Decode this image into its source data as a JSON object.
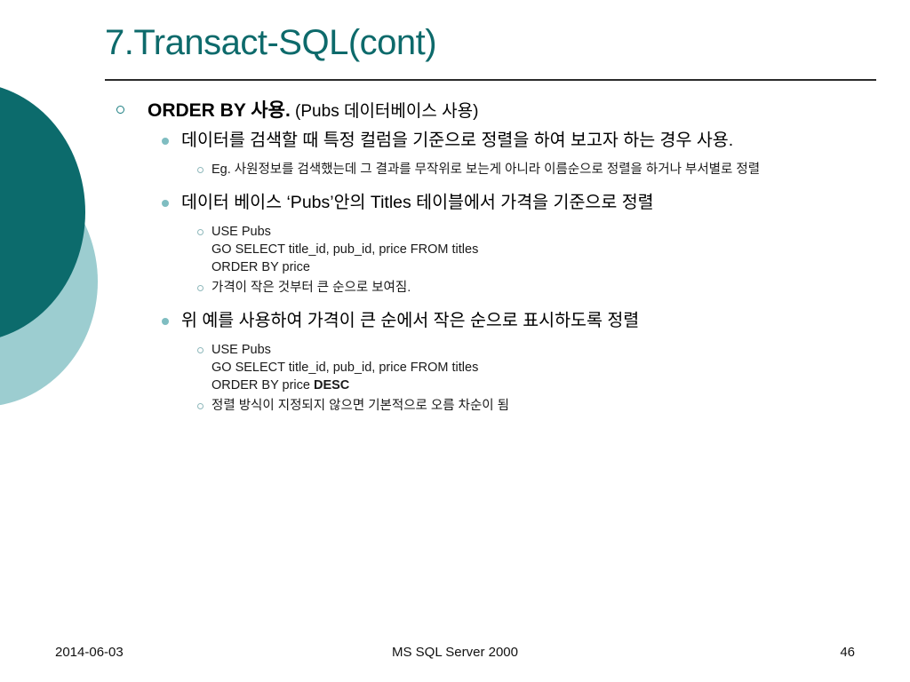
{
  "slide": {
    "title": "7.Transact-SQL(cont)",
    "content": {
      "l1_main": "ORDER BY 사용.",
      "l1_sub": " (Pubs 데이터베이스 사용)",
      "l2_a": "데이터를 검색할 때 특정 컬럼을 기준으로 정렬을 하여 보고자 하는 경우 사용.",
      "l3_a1": "Eg. 사원정보를 검색했는데 그 결과를 무작위로 보는게 아니라 이름순으로 정렬을 하거나 부서별로 정렬",
      "l2_b": " 데이터 베이스 ‘Pubs’안의 Titles 테이블에서 가격을 기준으로 정렬",
      "l3_b1_code": "USE Pubs\nGO SELECT title_id, pub_id, price FROM titles\nORDER BY price",
      "l3_b2": "가격이 작은 것부터 큰 순으로 보여짐.",
      "l2_c": "위 예를 사용하여 가격이 큰 순에서 작은 순으로 표시하도록 정렬",
      "l3_c1_code_head": "USE Pubs\nGO SELECT title_id, pub_id, price FROM titles\nORDER BY price ",
      "l3_c1_code_keyword": "DESC",
      "l3_c2": "정렬 방식이 지정되지 않으면 기본적으로 오름 차순이 됨"
    }
  },
  "footer": {
    "date": "2014-06-03",
    "center": "MS SQL Server 2000",
    "page": "46"
  },
  "theme": {
    "title_color": "#0d6a6b",
    "circle_dark": "#0c6b6c",
    "circle_light": "#9ccdd0",
    "bullet_l1": "#1a7d80",
    "bullet_l2": "#7fbdc1",
    "bullet_l3": "#8fb8bb",
    "rule_color": "#2b2b2b"
  }
}
